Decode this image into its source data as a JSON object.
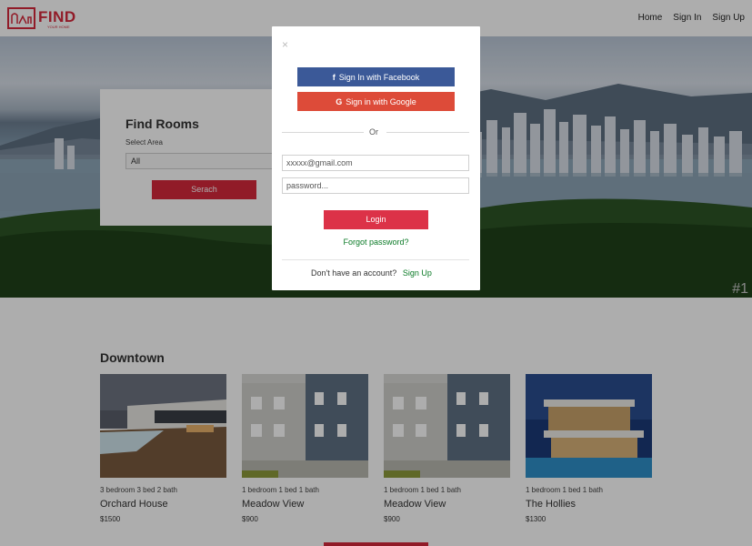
{
  "header": {
    "logo_text": "FIND",
    "logo_sub": "YOUR HOME",
    "nav": [
      "Home",
      "Sign In",
      "Sign Up"
    ]
  },
  "hero": {
    "corner_text": "#1",
    "find_panel": {
      "title": "Find Rooms",
      "select_label": "Select Area",
      "select_value": "All",
      "search_button": "Serach"
    }
  },
  "listings": {
    "section_title": "Downtown",
    "cards": [
      {
        "rooms": "3 bedroom 3 bed 2 bath",
        "name": "Orchard House",
        "price": "$1500"
      },
      {
        "rooms": "1 bedroom 1 bed 1 bath",
        "name": "Meadow View",
        "price": "$900"
      },
      {
        "rooms": "1 bedroom 1 bed 1 bath",
        "name": "Meadow View",
        "price": "$900"
      },
      {
        "rooms": "1 bedroom 1 bed 1 bath",
        "name": "The Hollies",
        "price": "$1300"
      }
    ]
  },
  "modal": {
    "close_glyph": "×",
    "facebook_button": "Sign In with Facebook",
    "google_button": "Sign in with Google",
    "or_text": "Or",
    "email_placeholder": "xxxxx@gmail.com",
    "password_placeholder": "password...",
    "login_button": "Login",
    "forgot_link": "Forgot password?",
    "no_account_text": "Don't have an account?",
    "signup_link": "Sign Up"
  },
  "colors": {
    "brand_red": "#d6283b",
    "facebook_blue": "#3b5998",
    "google_red": "#dd4b39",
    "link_green": "#0a7a26"
  }
}
